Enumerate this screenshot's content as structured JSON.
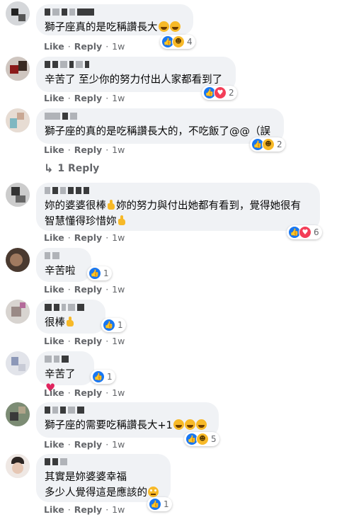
{
  "actions": {
    "like": "Like",
    "reply": "Reply",
    "dot": "·"
  },
  "view_replies": "1 Reply",
  "comments": [
    {
      "text": "獅子座真的是吃稱讚長大",
      "time": "1w",
      "reactions": "4",
      "react_icons": [
        "like-icon",
        "haha-icon"
      ]
    },
    {
      "text": "辛苦了 至少你的努力付出人家都看到了",
      "time": "1w",
      "reactions": "2",
      "react_icons": [
        "like-icon",
        "love-icon"
      ]
    },
    {
      "text": "獅子座的真的是吃稱讚長大的，不吃飯了@@（誤",
      "time": "1w",
      "reactions": "2",
      "react_icons": [
        "like-icon",
        "haha-icon"
      ]
    },
    {
      "text_line1": "妳的婆婆很棒",
      "text_line1b": "妳的努力與付出她都有看到，覺得她很有",
      "text_line2": "智慧懂得珍惜妳",
      "time": "1w",
      "reactions": "6",
      "react_icons": [
        "like-icon",
        "love-icon"
      ]
    },
    {
      "text": "辛苦啦",
      "time": "1w",
      "reactions": "1",
      "react_icons": [
        "like-icon"
      ]
    },
    {
      "text": "很棒",
      "time": "1w",
      "reactions": "1",
      "react_icons": [
        "like-icon"
      ]
    },
    {
      "text": "辛苦了",
      "time": "1w",
      "reactions": "1",
      "react_icons": [
        "like-icon"
      ]
    },
    {
      "text": "獅子座的需要吃稱讚長大+1",
      "time": "1w",
      "reactions": "5",
      "react_icons": [
        "like-icon",
        "haha-icon"
      ]
    },
    {
      "text_line1": "其實是妳婆婆幸福",
      "text_line2": "多少人覺得這是應該的",
      "time": "1w",
      "reactions": "1",
      "react_icons": [
        "like-icon"
      ]
    }
  ],
  "colors": {
    "bubble": "#f0f2f5",
    "like": "#1877f2",
    "love": "#f33e58",
    "haha": "#f7b928",
    "meta": "#65676b"
  }
}
